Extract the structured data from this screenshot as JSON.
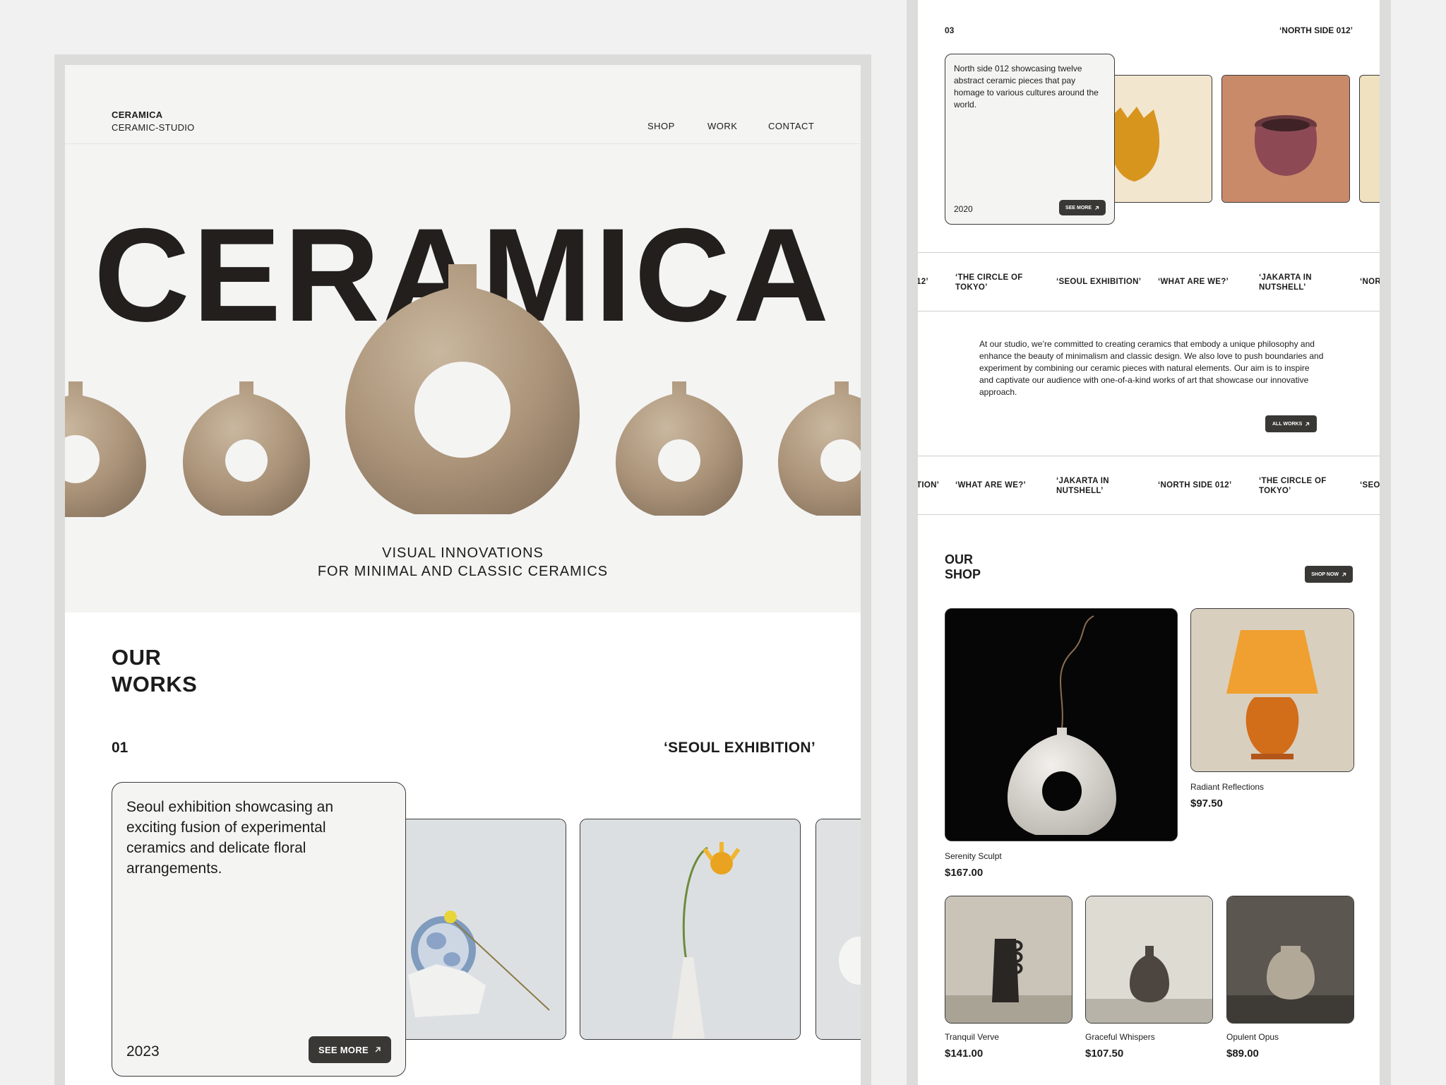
{
  "left": {
    "brand": {
      "name": "CERAMICA",
      "sub": "CERAMIC-STUDIO"
    },
    "nav": [
      "SHOP",
      "WORK",
      "CONTACT"
    ],
    "hero_title": "CERAMICA",
    "tagline": [
      "VISUAL INNOVATIONS",
      "FOR MINIMAL AND CLASSIC CERAMICS"
    ],
    "works": {
      "title": [
        "OUR",
        "WORKS"
      ],
      "number": "01",
      "name": "‘SEOUL EXHIBITION’",
      "description": "Seoul exhibition showcasing an exciting fusion of experimental ceramics and delicate floral arrangements.",
      "year": "2023",
      "see_more": "SEE MORE"
    }
  },
  "right": {
    "project": {
      "number": "03",
      "name": "‘NORTH SIDE 012’",
      "description": "North side 012 showcasing twelve abstract ceramic pieces that pay homage to various cultures around the world.",
      "year": "2020",
      "see_more": "SEE MORE"
    },
    "ticker1": [
      "12’",
      "‘THE CIRCLE OF TOKYO’",
      "‘SEOUL EXHIBITION’",
      "‘WHAT ARE WE?’",
      "‘JAKARTA IN NUTSHELL’",
      "‘NOR"
    ],
    "about": "At our studio, we’re committed to creating ceramics that embody a unique philosophy and enhance the beauty of minimalism and classic design. We also love to push boundaries and experiment by combining our ceramic pieces with natural elements. Our aim is to inspire and captivate our audience with one-of-a-kind works of art that showcase our innovative approach.",
    "all_works": "ALL WORKS",
    "ticker2": [
      "TION’",
      "‘WHAT ARE WE?’",
      "‘JAKARTA IN NUTSHELL’",
      "‘NORTH SIDE 012’",
      "‘THE CIRCLE OF TOKYO’",
      "‘SEOU"
    ],
    "shop": {
      "title": [
        "OUR",
        "SHOP"
      ],
      "shop_now": "SHOP NOW",
      "products": [
        {
          "name": "Serenity Sculpt",
          "price": "$167.00"
        },
        {
          "name": "Radiant Reflections",
          "price": "$97.50"
        },
        {
          "name": "Tranquil Verve",
          "price": "$141.00"
        },
        {
          "name": "Graceful Whispers",
          "price": "$107.50"
        },
        {
          "name": "Opulent Opus",
          "price": "$89.00"
        }
      ]
    }
  },
  "icons": {
    "arrow": "arrow-up-right-icon"
  },
  "colors": {
    "dark_button": "#3a3834",
    "vase": "#b09a7e",
    "text": "#1c1c1c"
  }
}
